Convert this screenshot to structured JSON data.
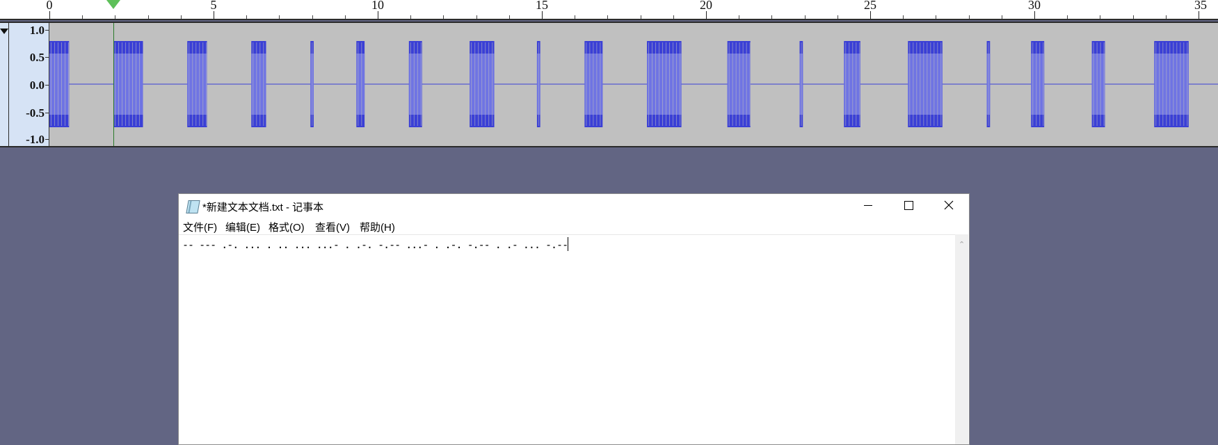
{
  "timeline": {
    "ruler_labels": [
      "0",
      "5",
      "10",
      "15",
      "20",
      "25",
      "30",
      "35"
    ],
    "ruler_max_seconds": 35,
    "track_amplitude_labels": [
      "1.0",
      "0.5",
      "0.0",
      "-0.5",
      "-1.0"
    ],
    "playhead_seconds": 1.95,
    "waveform_color": "#3a3fd6",
    "waveform_highlight_color": "#6f74e3",
    "track_background_color": "#c0c0c0",
    "sound_bursts_seconds": [
      [
        0.0,
        0.6
      ],
      [
        1.95,
        2.85
      ],
      [
        4.2,
        4.8
      ],
      [
        6.15,
        6.6
      ],
      [
        7.95,
        8.05
      ],
      [
        9.35,
        9.6
      ],
      [
        10.95,
        11.35
      ],
      [
        12.8,
        13.55
      ],
      [
        14.85,
        14.95
      ],
      [
        16.3,
        16.85
      ],
      [
        18.2,
        19.25
      ],
      [
        20.65,
        21.35
      ],
      [
        22.85,
        22.95
      ],
      [
        24.2,
        24.7
      ],
      [
        26.15,
        27.2
      ],
      [
        28.55,
        28.65
      ],
      [
        29.9,
        30.3
      ],
      [
        31.75,
        32.15
      ],
      [
        33.65,
        34.7
      ]
    ]
  },
  "notepad": {
    "title": "*新建文本文档.txt - 记事本",
    "menu": [
      "文件(F)",
      "编辑(E)",
      "格式(O)",
      "查看(V)",
      "帮助(H)"
    ],
    "content": "-- --- .-. ... . .. ... ...- . .-. -.-- ...- . .-. -.-- . .- ... -.--",
    "icons": {
      "app": "notepad-icon",
      "minimize": "minimize-icon",
      "maximize": "maximize-icon",
      "close": "close-icon"
    }
  }
}
